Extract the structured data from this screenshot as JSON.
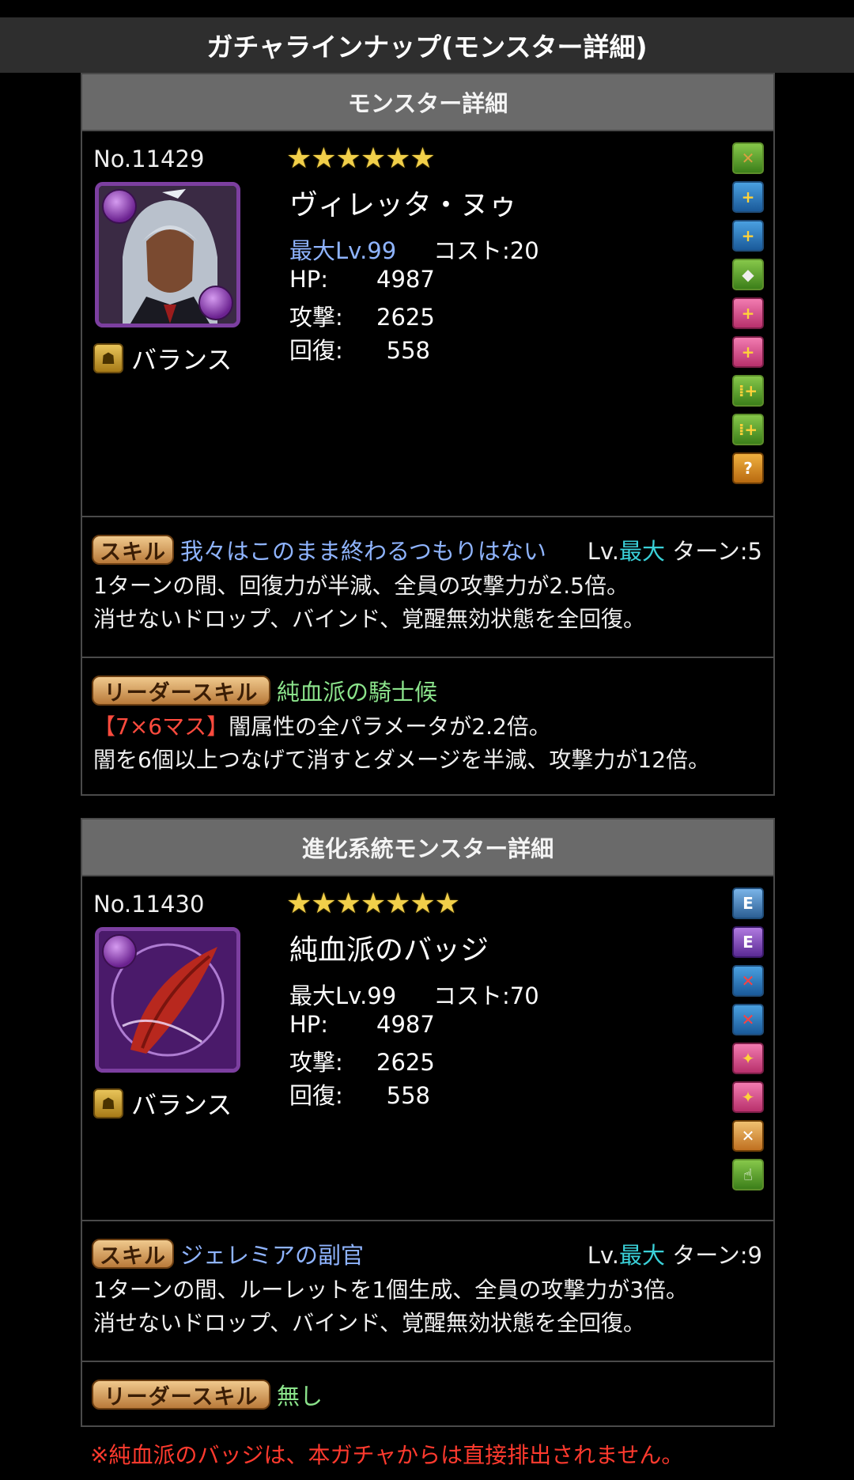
{
  "top_title": "ガチャラインナップ(モンスター詳細)",
  "cards": [
    {
      "header": "モンスター詳細",
      "no": "No.11429",
      "stars": "★★★★★★",
      "name": "ヴィレッタ・ヌゥ",
      "max_lv": "最大Lv.99",
      "cost": "コスト:20",
      "hp_label": "HP:",
      "hp": "4987",
      "atk_label": "攻撃:",
      "atk": "2625",
      "rcv_label": "回復:",
      "rcv": "558",
      "type": "バランス",
      "awakenings": [
        "remove-jammer-icon",
        "skill-boost-icon",
        "skill-boost-icon",
        "damage-reduction-icon",
        "recovery-plus-icon",
        "recovery-plus-icon",
        "enhanced-combo-icon",
        "enhanced-combo-icon",
        "auto-recover-icon"
      ],
      "skill_pill": "スキル",
      "skill_name": "我々はこのまま終わるつもりはない",
      "skill_lv_prefix": "Lv.",
      "skill_lv_max": "最大",
      "skill_turn": "ターン:5",
      "skill_desc_1": "1ターンの間、回復力が半減、全員の攻撃力が2.5倍。",
      "skill_desc_2": "消せないドロップ、バインド、覚醒無効状態を全回復。",
      "leader_pill": "リーダースキル",
      "leader_name": "純血派の騎士候",
      "leader_desc_red": "【7×6マス】",
      "leader_desc_1": "闇属性の全パラメータが2.2倍。",
      "leader_desc_2": "闇を6個以上つなげて消すとダメージを半減、攻撃力が12倍。"
    },
    {
      "header": "進化系統モンスター詳細",
      "no": "No.11430",
      "stars": "★★★★★★★",
      "name": "純血派のバッジ",
      "max_lv": "最大Lv.99",
      "cost": "コスト:70",
      "hp_label": "HP:",
      "hp": "4987",
      "atk_label": "攻撃:",
      "atk": "2625",
      "rcv_label": "回復:",
      "rcv": "558",
      "type": "バランス",
      "awakenings": [
        "equip-assist-icon",
        "equip-evolution-icon",
        "skill-charge-icon",
        "skill-charge-icon",
        "heal-orb-icon",
        "heal-orb-icon",
        "jammer-resist-icon",
        "finger-plus-icon"
      ],
      "skill_pill": "スキル",
      "skill_name": "ジェレミアの副官",
      "skill_lv_prefix": "Lv.",
      "skill_lv_max": "最大",
      "skill_turn": "ターン:9",
      "skill_desc_1": "1ターンの間、ルーレットを1個生成、全員の攻撃力が3倍。",
      "skill_desc_2": "消せないドロップ、バインド、覚醒無効状態を全回復。",
      "leader_pill": "リーダースキル",
      "leader_name": "無し"
    }
  ],
  "footnote": "※純血派のバッジは、本ガチャからは直接排出されません。"
}
